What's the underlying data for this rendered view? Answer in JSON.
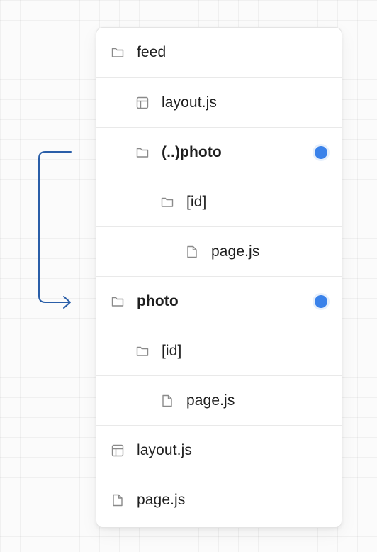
{
  "tree": {
    "rows": [
      {
        "label": "feed",
        "icon": "folder-icon",
        "level": 0,
        "bold": false,
        "marked": false
      },
      {
        "label": "layout.js",
        "icon": "layout-file-icon",
        "level": 1,
        "bold": false,
        "marked": false
      },
      {
        "label": "(..)photo",
        "icon": "folder-icon",
        "level": 1,
        "bold": true,
        "marked": true
      },
      {
        "label": "[id]",
        "icon": "folder-icon",
        "level": 2,
        "bold": false,
        "marked": false
      },
      {
        "label": "page.js",
        "icon": "file-icon",
        "level": 3,
        "bold": false,
        "marked": false
      },
      {
        "label": "photo",
        "icon": "folder-icon",
        "level": 0,
        "bold": true,
        "marked": true
      },
      {
        "label": "[id]",
        "icon": "folder-icon",
        "level": 1,
        "bold": false,
        "marked": false
      },
      {
        "label": "page.js",
        "icon": "file-icon",
        "level": 2,
        "bold": false,
        "marked": false
      },
      {
        "label": "layout.js",
        "icon": "layout-file-icon",
        "level": 0,
        "bold": false,
        "marked": false
      },
      {
        "label": "page.js",
        "icon": "file-icon",
        "level": 0,
        "bold": false,
        "marked": false
      }
    ]
  },
  "colors": {
    "marker_dot": "#3a82ea",
    "arrow": "#2a5ea8",
    "icon_stroke": "#8a8a8a",
    "text": "#1f1f1f"
  }
}
